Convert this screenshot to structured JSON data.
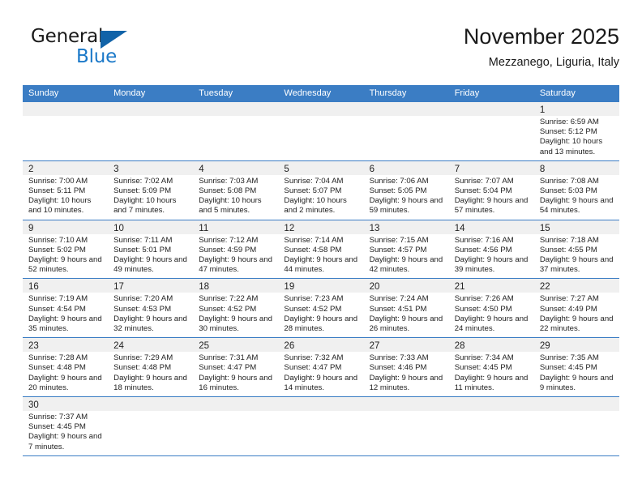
{
  "brand": {
    "name_part1": "General",
    "name_part2": "Blue",
    "accent_color": "#1a78c8",
    "triangle_color": "#1163a8"
  },
  "header": {
    "title": "November 2025",
    "subtitle": "Mezzanego, Liguria, Italy"
  },
  "theme": {
    "header_bg": "#3b7dc4",
    "day_band_bg": "#f0f0f0",
    "row_divider": "#3b7dc4"
  },
  "weekdays": [
    "Sunday",
    "Monday",
    "Tuesday",
    "Wednesday",
    "Thursday",
    "Friday",
    "Saturday"
  ],
  "weeks": [
    [
      {
        "day": "",
        "empty": true
      },
      {
        "day": "",
        "empty": true
      },
      {
        "day": "",
        "empty": true
      },
      {
        "day": "",
        "empty": true
      },
      {
        "day": "",
        "empty": true
      },
      {
        "day": "",
        "empty": true
      },
      {
        "day": "1",
        "sunrise": "Sunrise: 6:59 AM",
        "sunset": "Sunset: 5:12 PM",
        "daylight": "Daylight: 10 hours and 13 minutes."
      }
    ],
    [
      {
        "day": "2",
        "sunrise": "Sunrise: 7:00 AM",
        "sunset": "Sunset: 5:11 PM",
        "daylight": "Daylight: 10 hours and 10 minutes."
      },
      {
        "day": "3",
        "sunrise": "Sunrise: 7:02 AM",
        "sunset": "Sunset: 5:09 PM",
        "daylight": "Daylight: 10 hours and 7 minutes."
      },
      {
        "day": "4",
        "sunrise": "Sunrise: 7:03 AM",
        "sunset": "Sunset: 5:08 PM",
        "daylight": "Daylight: 10 hours and 5 minutes."
      },
      {
        "day": "5",
        "sunrise": "Sunrise: 7:04 AM",
        "sunset": "Sunset: 5:07 PM",
        "daylight": "Daylight: 10 hours and 2 minutes."
      },
      {
        "day": "6",
        "sunrise": "Sunrise: 7:06 AM",
        "sunset": "Sunset: 5:05 PM",
        "daylight": "Daylight: 9 hours and 59 minutes."
      },
      {
        "day": "7",
        "sunrise": "Sunrise: 7:07 AM",
        "sunset": "Sunset: 5:04 PM",
        "daylight": "Daylight: 9 hours and 57 minutes."
      },
      {
        "day": "8",
        "sunrise": "Sunrise: 7:08 AM",
        "sunset": "Sunset: 5:03 PM",
        "daylight": "Daylight: 9 hours and 54 minutes."
      }
    ],
    [
      {
        "day": "9",
        "sunrise": "Sunrise: 7:10 AM",
        "sunset": "Sunset: 5:02 PM",
        "daylight": "Daylight: 9 hours and 52 minutes."
      },
      {
        "day": "10",
        "sunrise": "Sunrise: 7:11 AM",
        "sunset": "Sunset: 5:01 PM",
        "daylight": "Daylight: 9 hours and 49 minutes."
      },
      {
        "day": "11",
        "sunrise": "Sunrise: 7:12 AM",
        "sunset": "Sunset: 4:59 PM",
        "daylight": "Daylight: 9 hours and 47 minutes."
      },
      {
        "day": "12",
        "sunrise": "Sunrise: 7:14 AM",
        "sunset": "Sunset: 4:58 PM",
        "daylight": "Daylight: 9 hours and 44 minutes."
      },
      {
        "day": "13",
        "sunrise": "Sunrise: 7:15 AM",
        "sunset": "Sunset: 4:57 PM",
        "daylight": "Daylight: 9 hours and 42 minutes."
      },
      {
        "day": "14",
        "sunrise": "Sunrise: 7:16 AM",
        "sunset": "Sunset: 4:56 PM",
        "daylight": "Daylight: 9 hours and 39 minutes."
      },
      {
        "day": "15",
        "sunrise": "Sunrise: 7:18 AM",
        "sunset": "Sunset: 4:55 PM",
        "daylight": "Daylight: 9 hours and 37 minutes."
      }
    ],
    [
      {
        "day": "16",
        "sunrise": "Sunrise: 7:19 AM",
        "sunset": "Sunset: 4:54 PM",
        "daylight": "Daylight: 9 hours and 35 minutes."
      },
      {
        "day": "17",
        "sunrise": "Sunrise: 7:20 AM",
        "sunset": "Sunset: 4:53 PM",
        "daylight": "Daylight: 9 hours and 32 minutes."
      },
      {
        "day": "18",
        "sunrise": "Sunrise: 7:22 AM",
        "sunset": "Sunset: 4:52 PM",
        "daylight": "Daylight: 9 hours and 30 minutes."
      },
      {
        "day": "19",
        "sunrise": "Sunrise: 7:23 AM",
        "sunset": "Sunset: 4:52 PM",
        "daylight": "Daylight: 9 hours and 28 minutes."
      },
      {
        "day": "20",
        "sunrise": "Sunrise: 7:24 AM",
        "sunset": "Sunset: 4:51 PM",
        "daylight": "Daylight: 9 hours and 26 minutes."
      },
      {
        "day": "21",
        "sunrise": "Sunrise: 7:26 AM",
        "sunset": "Sunset: 4:50 PM",
        "daylight": "Daylight: 9 hours and 24 minutes."
      },
      {
        "day": "22",
        "sunrise": "Sunrise: 7:27 AM",
        "sunset": "Sunset: 4:49 PM",
        "daylight": "Daylight: 9 hours and 22 minutes."
      }
    ],
    [
      {
        "day": "23",
        "sunrise": "Sunrise: 7:28 AM",
        "sunset": "Sunset: 4:48 PM",
        "daylight": "Daylight: 9 hours and 20 minutes."
      },
      {
        "day": "24",
        "sunrise": "Sunrise: 7:29 AM",
        "sunset": "Sunset: 4:48 PM",
        "daylight": "Daylight: 9 hours and 18 minutes."
      },
      {
        "day": "25",
        "sunrise": "Sunrise: 7:31 AM",
        "sunset": "Sunset: 4:47 PM",
        "daylight": "Daylight: 9 hours and 16 minutes."
      },
      {
        "day": "26",
        "sunrise": "Sunrise: 7:32 AM",
        "sunset": "Sunset: 4:47 PM",
        "daylight": "Daylight: 9 hours and 14 minutes."
      },
      {
        "day": "27",
        "sunrise": "Sunrise: 7:33 AM",
        "sunset": "Sunset: 4:46 PM",
        "daylight": "Daylight: 9 hours and 12 minutes."
      },
      {
        "day": "28",
        "sunrise": "Sunrise: 7:34 AM",
        "sunset": "Sunset: 4:45 PM",
        "daylight": "Daylight: 9 hours and 11 minutes."
      },
      {
        "day": "29",
        "sunrise": "Sunrise: 7:35 AM",
        "sunset": "Sunset: 4:45 PM",
        "daylight": "Daylight: 9 hours and 9 minutes."
      }
    ],
    [
      {
        "day": "30",
        "sunrise": "Sunrise: 7:37 AM",
        "sunset": "Sunset: 4:45 PM",
        "daylight": "Daylight: 9 hours and 7 minutes."
      },
      {
        "day": "",
        "empty": true
      },
      {
        "day": "",
        "empty": true
      },
      {
        "day": "",
        "empty": true
      },
      {
        "day": "",
        "empty": true
      },
      {
        "day": "",
        "empty": true
      },
      {
        "day": "",
        "empty": true
      }
    ]
  ]
}
